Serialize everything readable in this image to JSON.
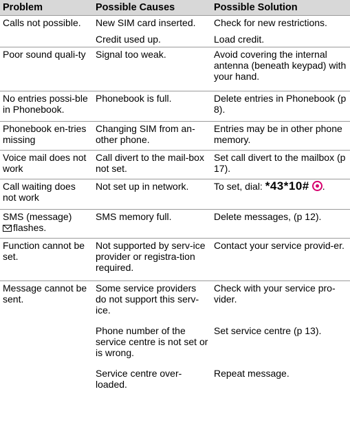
{
  "headers": {
    "problem": "Problem",
    "causes": "Possible Causes",
    "solution": "Possible Solution"
  },
  "rows": [
    {
      "problem": "Calls not possible.",
      "cause": "New SIM card inserted.",
      "solution": "Check for new restrictions."
    },
    {
      "problem": "",
      "cause": "Credit used up.",
      "solution": "Load credit."
    },
    {
      "problem": "Poor sound quali-ty",
      "cause": "Signal too weak.",
      "solution": "Avoid covering the internal antenna (beneath keypad) with your hand."
    },
    {
      "problem": "No entries possi-ble in Phonebook.",
      "cause": "Phonebook is full.",
      "solution": "Delete entries in Phonebook (p 8)."
    },
    {
      "problem": "Phonebook en-tries missing",
      "cause": "Changing SIM from an-other phone.",
      "solution": "Entries may be in other phone memory."
    },
    {
      "problem": "Voice mail does not work",
      "cause": "Call divert to the mail-box not set.",
      "solution": "Set call divert to the mailbox (p 17)."
    },
    {
      "problem": "Call waiting does not work",
      "cause": "Not set up in network.",
      "solution_prefix": "To set, dial:",
      "solution_code": "*43*10#"
    },
    {
      "problem_prefix": "SMS (message)",
      "problem_suffix": "flashes.",
      "cause": "SMS memory full.",
      "solution": "Delete messages, (p 12)."
    },
    {
      "problem": "Function cannot be set.",
      "cause": "Not supported by serv-ice provider or registra-tion required.",
      "solution": "Contact your service provid-er."
    },
    {
      "problem": "Message cannot be sent.",
      "cause": "Some service providers do not support this serv-ice.",
      "solution": "Check with your service pro-vider."
    },
    {
      "problem": "",
      "cause": "Phone number of the service centre is not set or is wrong.",
      "solution": "Set service centre (p 13)."
    },
    {
      "problem": "",
      "cause": "Service centre over-loaded.",
      "solution": "Repeat message."
    }
  ],
  "icons": {
    "select": "select-key-icon",
    "envelope": "envelope-icon",
    "accent": "#d6006e"
  }
}
